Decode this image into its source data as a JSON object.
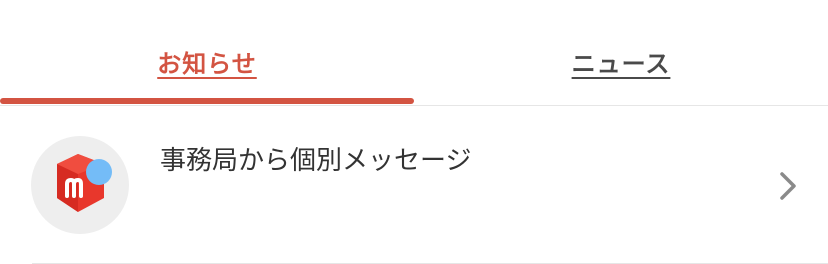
{
  "tabs": {
    "notices_label": "お知らせ",
    "news_label": "ニュース",
    "active_tab": "お知らせ",
    "accent_color": "#d35442"
  },
  "notifications": [
    {
      "title": "事務局から個別メッセージ",
      "icon": "mercari-logo-icon",
      "unread": true,
      "unread_dot_color": "#74bcf7"
    }
  ],
  "icons": {
    "row_chevron": "chevron-right-icon"
  }
}
